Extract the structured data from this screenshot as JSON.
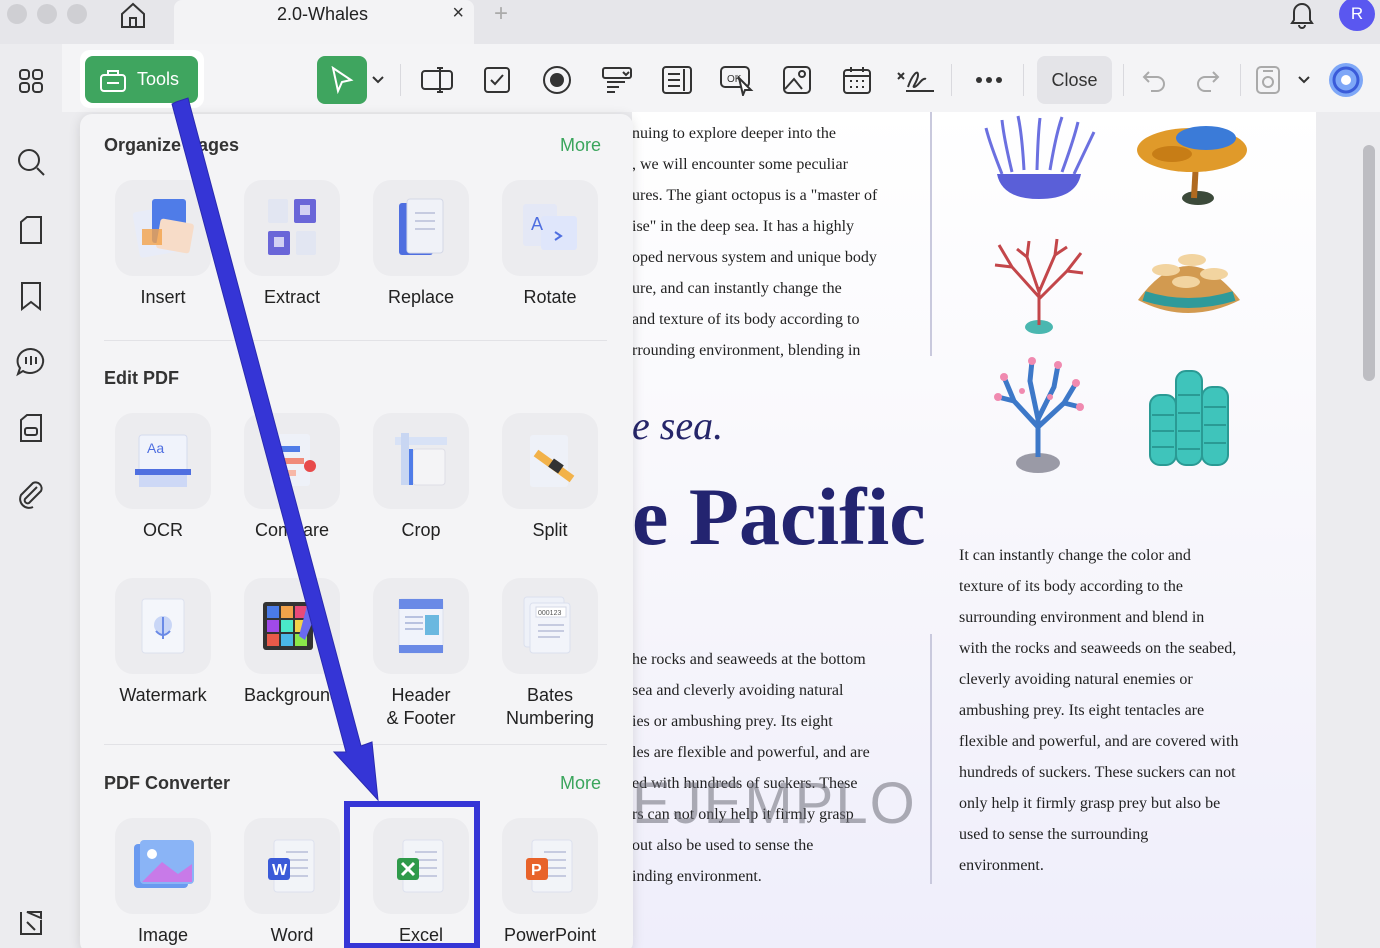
{
  "tabbar": {
    "doc_title": "2.0-Whales",
    "close_glyph": "×",
    "new_tab_glyph": "+",
    "avatar_initial": "R"
  },
  "toolbar": {
    "tools_label": "Tools",
    "close_label": "Close",
    "icons": [
      "select-icon",
      "chevron-down-icon",
      "text-field-icon",
      "checkbox-icon",
      "radio-icon",
      "combo-box-icon",
      "list-box-icon",
      "button-icon",
      "image-field-icon",
      "date-field-icon",
      "signature-field-icon",
      "more-icon",
      "undo-icon",
      "redo-icon",
      "save-icon",
      "chevron-down-icon",
      "ai-assistant-icon"
    ]
  },
  "rail": {
    "icons": [
      "grid-icon",
      "search-icon",
      "page-icon",
      "bookmark-icon",
      "comment-icon",
      "form-icon",
      "attachment-icon",
      "layers-icon"
    ]
  },
  "panel": {
    "organize": {
      "title": "Organize Pages",
      "more": "More",
      "items": [
        {
          "label": "Insert",
          "icon": "insert-icon"
        },
        {
          "label": "Extract",
          "icon": "extract-icon"
        },
        {
          "label": "Replace",
          "icon": "replace-icon"
        },
        {
          "label": "Rotate",
          "icon": "rotate-icon"
        }
      ]
    },
    "edit": {
      "title": "Edit PDF",
      "items": [
        {
          "label": "OCR",
          "icon": "ocr-icon"
        },
        {
          "label": "Compare",
          "icon": "compare-icon"
        },
        {
          "label": "Crop",
          "icon": "crop-icon"
        },
        {
          "label": "Split",
          "icon": "split-icon"
        },
        {
          "label": "Watermark",
          "icon": "watermark-icon"
        },
        {
          "label": "Background",
          "icon": "background-icon"
        },
        {
          "label": "Header",
          "label2": "& Footer",
          "icon": "header-footer-icon"
        },
        {
          "label": "Bates",
          "label2": "Numbering",
          "icon": "bates-numbering-icon"
        }
      ]
    },
    "converter": {
      "title": "PDF Converter",
      "more": "More",
      "items": [
        {
          "label": "Image",
          "icon": "image-icon"
        },
        {
          "label": "Word",
          "icon": "word-icon"
        },
        {
          "label": "Excel",
          "icon": "excel-icon"
        },
        {
          "label": "PowerPoint",
          "icon": "powerpoint-icon"
        }
      ]
    }
  },
  "document": {
    "col_a_top": [
      "nuing to explore deeper into the",
      ", we will encounter some peculiar",
      "ures. The giant octopus is a \"master of",
      "ise\" in the deep sea. It has a highly",
      "oped nervous system and unique body",
      "ure, and can instantly change the",
      "and texture of its body according to",
      "rrounding environment, blending in"
    ],
    "heading_sea": "e sea.",
    "heading_pacific": "e Pacific",
    "col_a_bottom": [
      "he rocks and seaweeds at the bottom",
      " sea and cleverly avoiding natural",
      "ies or ambushing prey. Its eight",
      "les are flexible and powerful, and are",
      "ed with hundreds of suckers. These",
      "rs can not only help it firmly grasp",
      "out also be used to sense the",
      "inding environment."
    ],
    "col_b": [
      "It can instantly change the color and",
      "texture of its body according to the",
      "surrounding environment and blend in",
      "with the rocks and seaweeds on the seabed,",
      "cleverly avoiding natural enemies or",
      "ambushing prey. Its eight tentacles are",
      "flexible and powerful, and are covered with",
      "hundreds of suckers. These suckers can not",
      "only help it firmly grasp prey but also be",
      "used to sense the surrounding",
      "environment."
    ],
    "watermark": "EJEMPLO",
    "coral_images": [
      "anemone-image",
      "orange-coral-image",
      "red-coral-image",
      "mushroom-coral-image",
      "pink-coral-image",
      "tube-coral-image"
    ]
  },
  "annotation": {
    "arrow_color": "#3535d6",
    "box_color": "#3535d6"
  }
}
